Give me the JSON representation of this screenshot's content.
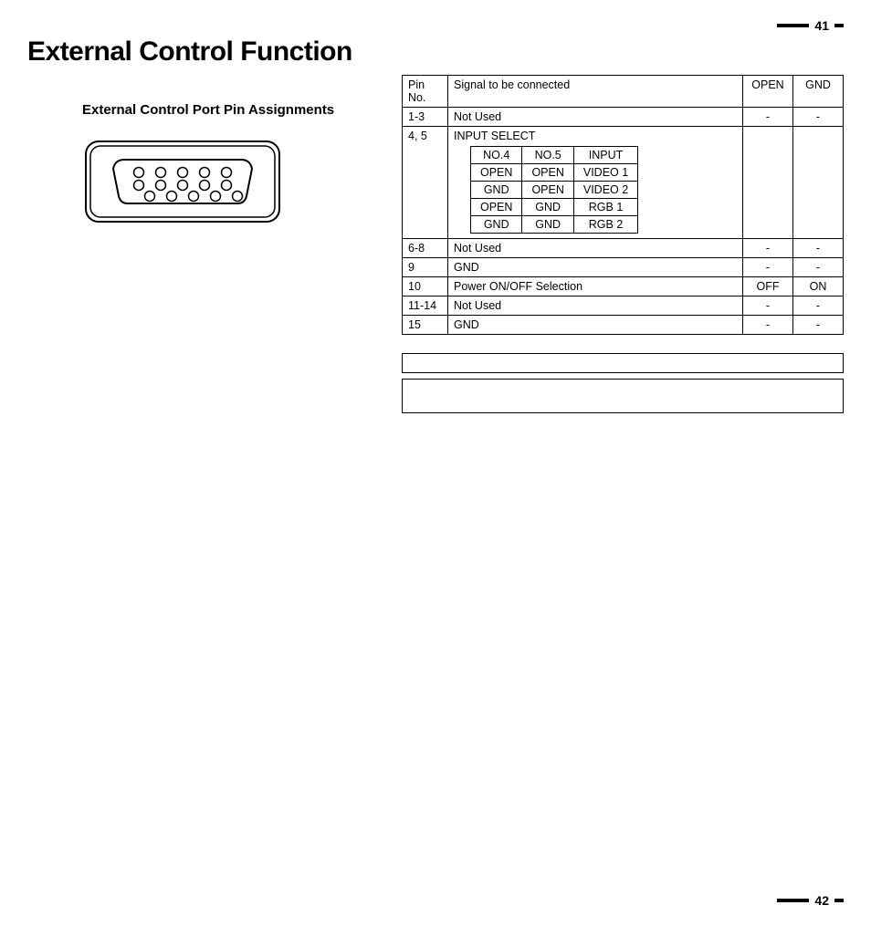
{
  "page_number_top": "41",
  "page_number_bottom": "42",
  "title": "External Control Function",
  "subtitle": "External Control Port Pin Assignments",
  "table": {
    "headers": {
      "pin": "Pin No.",
      "signal": "Signal to be connected",
      "open": "OPEN",
      "gnd": "GND"
    },
    "rows": [
      {
        "pin": "1-3",
        "signal": "Not Used",
        "open": "-",
        "gnd": "-"
      },
      {
        "pin": "4, 5",
        "signal": "INPUT SELECT",
        "open": "",
        "gnd": ""
      },
      {
        "pin": "6-8",
        "signal": "Not Used",
        "open": "-",
        "gnd": "-"
      },
      {
        "pin": "9",
        "signal": "GND",
        "open": "-",
        "gnd": "-"
      },
      {
        "pin": "10",
        "signal": "Power ON/OFF Selection",
        "open": "OFF",
        "gnd": "ON"
      },
      {
        "pin": "11-14",
        "signal": "Not Used",
        "open": "-",
        "gnd": "-"
      },
      {
        "pin": "15",
        "signal": "GND",
        "open": "-",
        "gnd": "-"
      }
    ],
    "input_select": {
      "headers": {
        "c1": "NO.4",
        "c2": "NO.5",
        "c3": "INPUT"
      },
      "rows": [
        {
          "c1": "OPEN",
          "c2": "OPEN",
          "c3": "VIDEO 1"
        },
        {
          "c1": "GND",
          "c2": "OPEN",
          "c3": "VIDEO 2"
        },
        {
          "c1": "OPEN",
          "c2": "GND",
          "c3": "RGB 1"
        },
        {
          "c1": "GND",
          "c2": "GND",
          "c3": "RGB 2"
        }
      ]
    }
  }
}
